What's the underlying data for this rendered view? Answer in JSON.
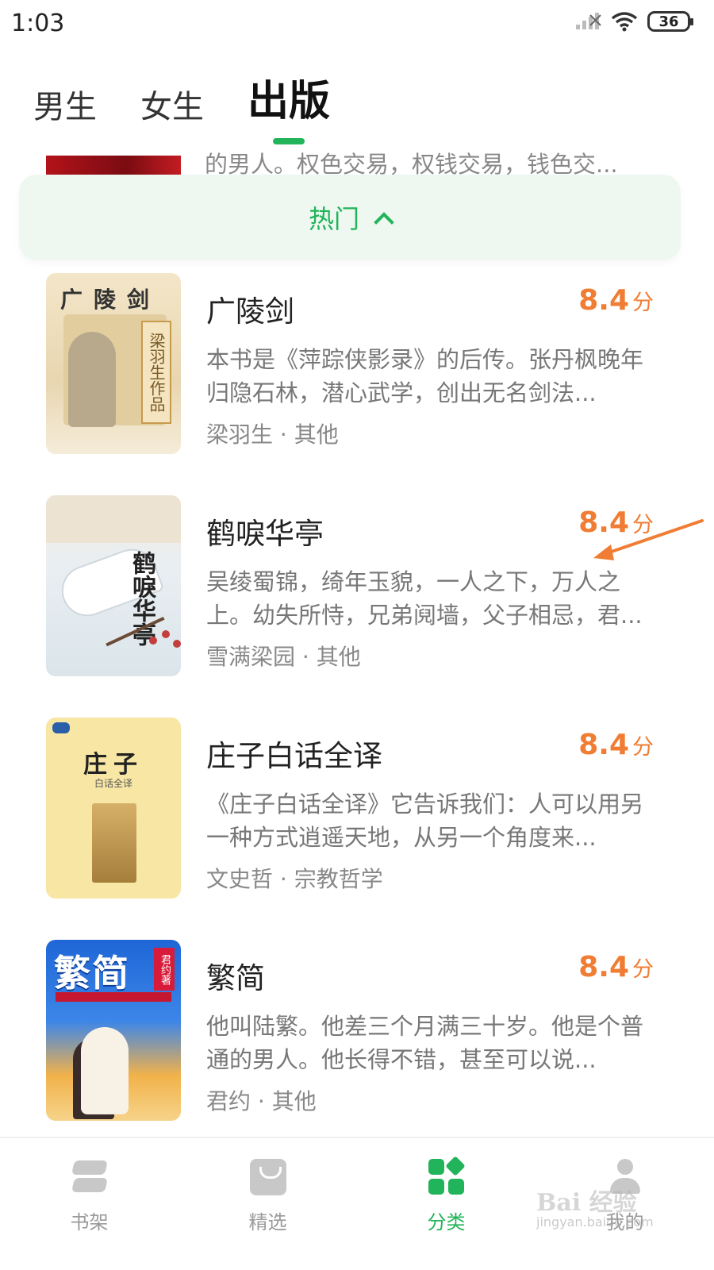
{
  "status_bar": {
    "time": "1:03",
    "battery": "36"
  },
  "tabs": [
    {
      "label": "男生",
      "active": false
    },
    {
      "label": "女生",
      "active": false
    },
    {
      "label": "出版",
      "active": true
    }
  ],
  "accent_color": "#21b45a",
  "score_color": "#f07d33",
  "partial_book": {
    "desc": "的男人。权色交易，权钱交易，钱色交..."
  },
  "filter": {
    "label": "热门",
    "icon": "chevron-up-icon"
  },
  "books": [
    {
      "title": "广陵剑",
      "score": "8.4",
      "score_unit": "分",
      "desc": "本书是《萍踪侠影录》的后传。张丹枫晚年归隐石林，潜心武学，创出无名剑法...",
      "meta": "梁羽生 · 其他",
      "cover_text": "广陵剑",
      "cover_author": "梁羽生作品"
    },
    {
      "title": "鹤唳华亭",
      "score": "8.4",
      "score_unit": "分",
      "desc": "吴绫蜀锦，绮年玉貌，一人之下，万人之上。幼失所恃，兄弟阋墙，父子相忌，君...",
      "meta": "雪满梁园 · 其他",
      "cover_text": "鹤唳华亭"
    },
    {
      "title": "庄子白话全译",
      "score": "8.4",
      "score_unit": "分",
      "desc": "《庄子白话全译》它告诉我们：人可以用另一种方式逍遥天地，从另一个角度来...",
      "meta": "文史哲 · 宗教哲学",
      "cover_text": "庄子",
      "cover_sub": "白话全译"
    },
    {
      "title": "繁简",
      "score": "8.4",
      "score_unit": "分",
      "desc": "他叫陆繁。他差三个月满三十岁。他是个普通的男人。他长得不错，甚至可以说...",
      "meta": "君约 · 其他",
      "cover_text": "繁简",
      "cover_tag": "君约著"
    }
  ],
  "bottom_nav": [
    {
      "label": "书架",
      "icon": "bookshelf-icon",
      "active": false
    },
    {
      "label": "精选",
      "icon": "shopping-bag-icon",
      "active": false
    },
    {
      "label": "分类",
      "icon": "category-grid-icon",
      "active": true
    },
    {
      "label": "我的",
      "icon": "user-icon",
      "active": false
    }
  ],
  "watermark": {
    "text": "Bai 经验",
    "sub": "jingyan.baidu.com"
  }
}
